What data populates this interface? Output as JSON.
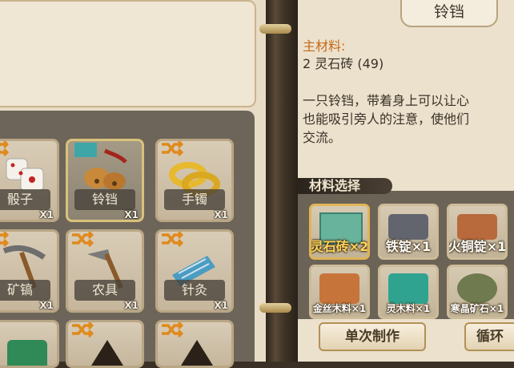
{
  "item_grid": {
    "cells": [
      {
        "label": "骰子",
        "count": "X1",
        "icon": "dice-icon"
      },
      {
        "label": "铃铛",
        "count": "X1",
        "icon": "bell-icon"
      },
      {
        "label": "手镯",
        "count": "X1",
        "icon": "bracelet-icon"
      },
      {
        "label": "矿镐",
        "count": "X1",
        "icon": "pickaxe-icon"
      },
      {
        "label": "农具",
        "count": "X1",
        "icon": "hoe-icon"
      },
      {
        "label": "针灸",
        "count": "X1",
        "icon": "acupuncture-needles-icon"
      }
    ],
    "selected_index": 1
  },
  "detail": {
    "title": "铃铛",
    "main_material_heading": "主材料:",
    "main_material_value": "2 灵石砖 (49)",
    "description_lines": [
      "一只铃铛，带着身上可以让心",
      "也能吸引旁人的注意，使他们",
      "交流。"
    ]
  },
  "materials": {
    "section_title": "材料选择",
    "items": [
      {
        "label": "灵石砖×2",
        "icon": "spirit-stone-brick-icon",
        "selected": true
      },
      {
        "label": "铁锭×1",
        "icon": "iron-ingot-icon",
        "selected": false
      },
      {
        "label": "火铜锭×1",
        "icon": "fire-copper-ingot-icon",
        "selected": false
      },
      {
        "label": "金丝木料×1",
        "icon": "golden-wood-icon",
        "selected": false
      },
      {
        "label": "灵木料×1",
        "icon": "spirit-wood-icon",
        "selected": false
      },
      {
        "label": "寒晶矿石×1",
        "icon": "frost-crystal-ore-icon",
        "selected": false
      }
    ]
  },
  "actions": {
    "single_craft_label": "单次制作",
    "loop_label": "循环"
  },
  "colors": {
    "accent_orange": "#c46a1b",
    "highlight_yellow": "#ffd55a"
  }
}
